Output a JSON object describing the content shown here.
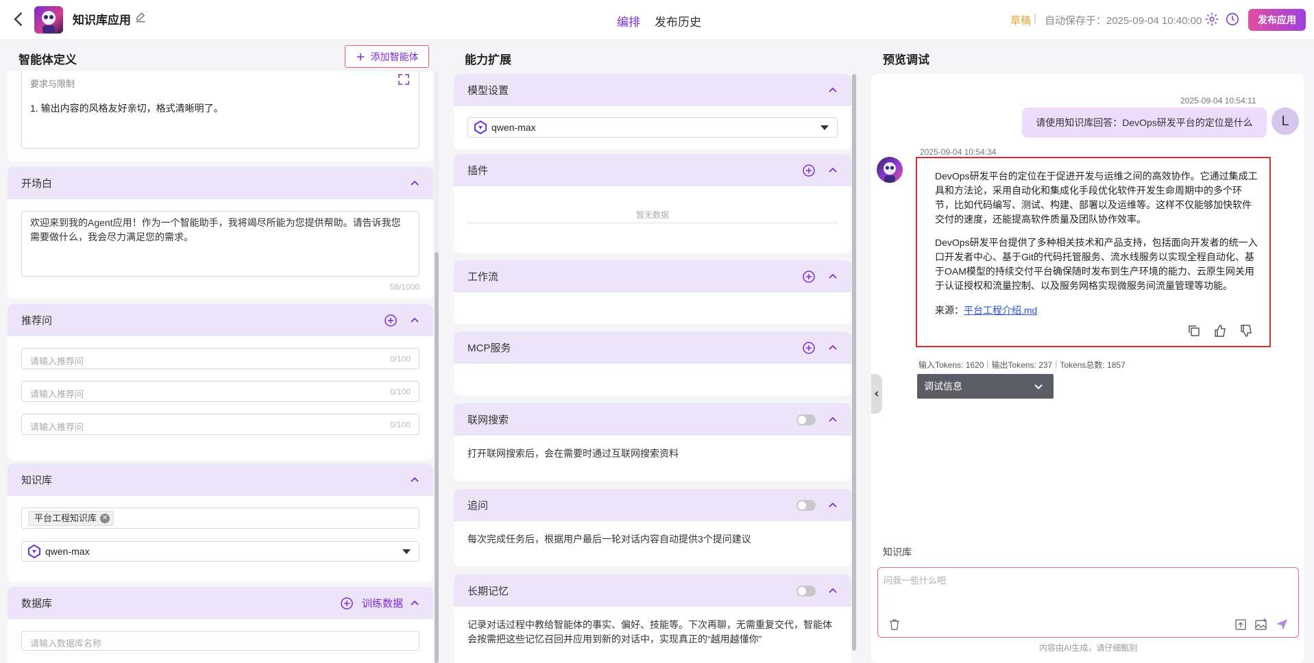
{
  "header": {
    "app_title": "知识库应用",
    "tabs": [
      {
        "label": "编排",
        "active": true
      },
      {
        "label": "发布历史",
        "active": false
      }
    ],
    "status": "草稿",
    "separator": "|",
    "autosave": "自动保存于：2025-09-04 10:40:00",
    "publish_label": "发布应用"
  },
  "columns": {
    "agent_def": "智能体定义",
    "capability": "能力扩展",
    "preview": "预览调试"
  },
  "agent": {
    "add_agent_label": "添加智能体",
    "requirements": {
      "title": "要求与限制",
      "content": "1.  输出内容的风格友好亲切，格式清晰明了。"
    },
    "opening": {
      "title": "开场白",
      "line1": "欢迎来到我的Agent应用！作为一个智能助手，我将竭尽所能为您提供帮助。请告诉我您",
      "line2": "需要做什么，我会尽力满足您的需求。",
      "counter": "58/1000"
    },
    "suggest": {
      "title": "推荐问",
      "placeholder": "请输入推荐问",
      "counter": "0/100"
    },
    "knowledge": {
      "title": "知识库",
      "tag": "平台工程知识库",
      "model": "qwen-max"
    },
    "database": {
      "title": "数据库",
      "train_label": "训练数据",
      "placeholder": "请输入数据库名称"
    }
  },
  "capability": {
    "model_settings": {
      "title": "模型设置",
      "model": "qwen-max"
    },
    "plugins": {
      "title": "插件",
      "empty": "暂无数据"
    },
    "workflow": {
      "title": "工作流"
    },
    "mcp": {
      "title": "MCP服务"
    },
    "web_search": {
      "title": "联网搜索",
      "enabled": false,
      "desc": "打开联网搜索后，会在需要时通过互联网搜索资料"
    },
    "followup": {
      "title": "追问",
      "enabled": false,
      "desc": "每次完成任务后，根据用户最后一轮对话内容自动提供3个提问建议"
    },
    "memory": {
      "title": "长期记忆",
      "enabled": false,
      "line1": "记录对话过程中教给智能体的事实、偏好、技能等。下次再聊，无需重复交代，智能体",
      "line2": "会按需把这些记忆召回并应用到新的对话中，实现真正的“越用越懂你”"
    }
  },
  "preview": {
    "user_time": "2025-09-04 10:54:11",
    "user_message": "请使用知识库回答：DevOps研发平台的定位是什么",
    "user_initial": "L",
    "bot_time": "2025-09-04 10:54:34",
    "answer_p1": [
      "DevOps研发平台的定位在于促进开发与运维之间的高效协作。它通过集成工",
      "具和方法论，采用自动化和集成化手段优化软件开发生命周期中的多个环",
      "节，比如代码编写、测试、构建、部署以及运维等。这样不仅能够加快软件",
      "交付的速度，还能提高软件质量及团队协作效率。"
    ],
    "answer_p2": [
      "DevOps研发平台提供了多种相关技术和产品支持，包括面向开发者的统一入",
      "口开发者中心、基于Git的代码托管服务、流水线服务以实现全程自动化、基",
      "于OAM模型的持续交付平台确保随时发布到生产环境的能力、云原生网关用",
      "于认证授权和流量控制、以及服务网格实现微服务间流量管理等功能。"
    ],
    "source_label": "来源：",
    "source_link": "平台工程介绍.md",
    "tokens": {
      "input": "输入Tokens: 1620",
      "output": "输出Tokens: 237",
      "total": "Tokens总数: 1857",
      "sep": "|"
    },
    "debug_label": "调试信息",
    "kb_label": "知识库",
    "input_placeholder": "问我一些什么吧",
    "disclaimer": "内容由AI生成，请仔细甄别"
  },
  "colors": {
    "accent": "#7b2bd8",
    "section_bg": "#ede4f9",
    "highlight_border": "#e02b2b",
    "draft": "#f0a030"
  }
}
